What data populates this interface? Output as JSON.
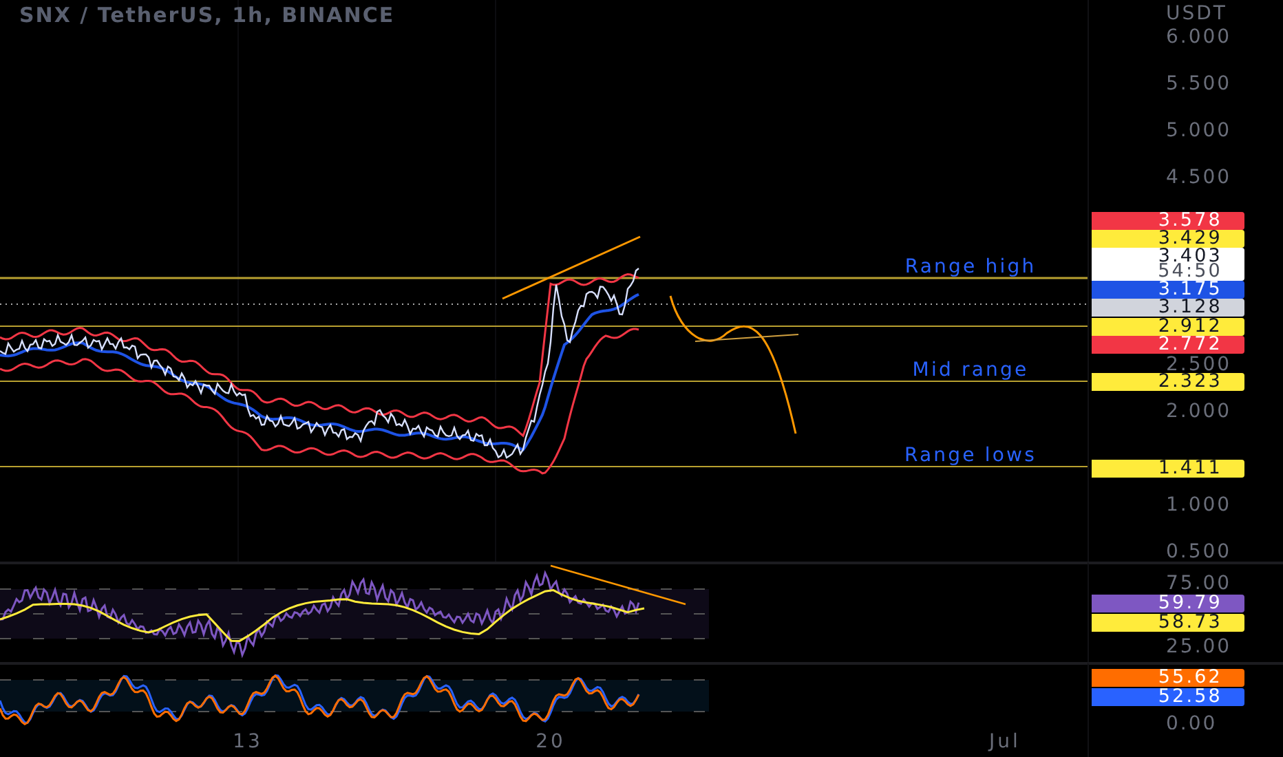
{
  "title": "SNX / TetherUS, 1h, BINANCE",
  "price_axis": {
    "unit": "USDT",
    "ticks": [
      "6.000",
      "5.500",
      "5.000",
      "4.500",
      "2.500",
      "2.000",
      "1.000",
      "0.500"
    ]
  },
  "price_labels": [
    {
      "value": "3.578",
      "color": "#f23645"
    },
    {
      "value": "3.429",
      "color": "#ffeb3b"
    },
    {
      "value": "3.403",
      "countdown": "54:50",
      "color": "#ffffff"
    },
    {
      "value": "3.175",
      "color": "#1e53e5"
    },
    {
      "value": "3.128",
      "color": "#d1d4dc"
    },
    {
      "value": "2.912",
      "color": "#ffeb3b"
    },
    {
      "value": "2.772",
      "color": "#f23645"
    },
    {
      "value": "2.323",
      "color": "#ffeb3b"
    },
    {
      "value": "1.411",
      "color": "#ffeb3b"
    }
  ],
  "annotations": [
    "Range high",
    "Mid range",
    "Range lows"
  ],
  "rsi": {
    "ticks": [
      "75.00",
      "25.00"
    ],
    "labels": [
      {
        "value": "59.79",
        "color": "#7e57c2"
      },
      {
        "value": "58.73",
        "color": "#ffeb3b"
      }
    ]
  },
  "stoch": {
    "ticks": [
      "0.00"
    ],
    "labels": [
      {
        "value": "55.62",
        "color": "#ff6d00"
      },
      {
        "value": "52.58",
        "color": "#2962ff"
      }
    ]
  },
  "time_axis": [
    "13",
    "20",
    "Jul"
  ]
}
